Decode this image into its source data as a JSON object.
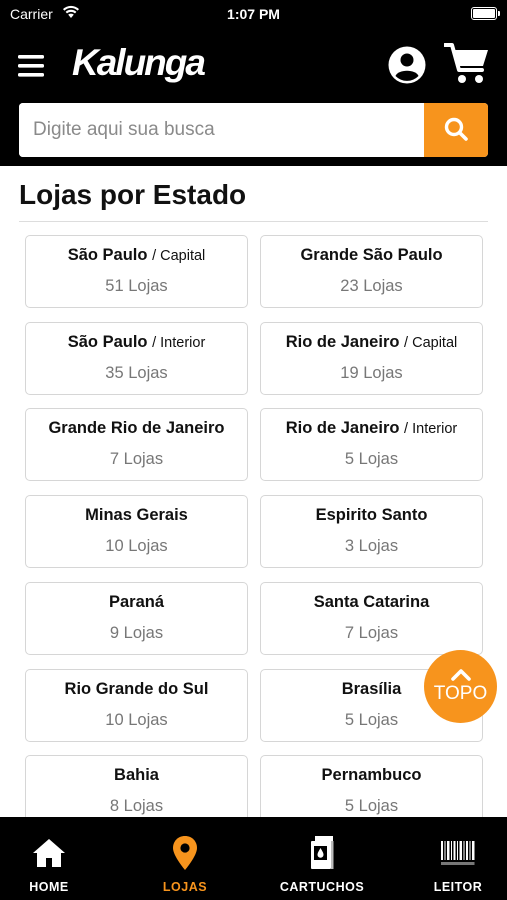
{
  "status_bar": {
    "carrier": "Carrier",
    "time": "1:07 PM",
    "battery_level": 1.0
  },
  "header": {
    "logo": "Kalunga",
    "icons": {
      "menu": "hamburger-menu-icon",
      "account": "account-icon",
      "cart": "shopping-cart-icon"
    }
  },
  "search": {
    "placeholder": "Digite aqui sua busca",
    "value": "",
    "button_icon": "search-icon"
  },
  "section_title": "Lojas por Estado",
  "stores": [
    {
      "name": "São Paulo",
      "qualifier": "/ Capital",
      "count": "51 Lojas"
    },
    {
      "name": "Grande São Paulo",
      "qualifier": "",
      "count": "23 Lojas"
    },
    {
      "name": "São Paulo",
      "qualifier": "/ Interior",
      "count": "35 Lojas"
    },
    {
      "name": "Rio de Janeiro",
      "qualifier": "/ Capital",
      "count": "19 Lojas"
    },
    {
      "name": "Grande Rio de Janeiro",
      "qualifier": "",
      "count": "7 Lojas"
    },
    {
      "name": "Rio de Janeiro",
      "qualifier": "/ Interior",
      "count": "5 Lojas"
    },
    {
      "name": "Minas Gerais",
      "qualifier": "",
      "count": "10 Lojas"
    },
    {
      "name": "Espirito Santo",
      "qualifier": "",
      "count": "3 Lojas"
    },
    {
      "name": "Paraná",
      "qualifier": "",
      "count": "9 Lojas"
    },
    {
      "name": "Santa Catarina",
      "qualifier": "",
      "count": "7 Lojas"
    },
    {
      "name": "Rio Grande do Sul",
      "qualifier": "",
      "count": "10 Lojas"
    },
    {
      "name": "Brasília",
      "qualifier": "",
      "count": "5 Lojas"
    },
    {
      "name": "Bahia",
      "qualifier": "",
      "count": "8 Lojas"
    },
    {
      "name": "Pernambuco",
      "qualifier": "",
      "count": "5 Lojas"
    }
  ],
  "top_button": {
    "label": "TOPO",
    "icon": "chevron-up-icon"
  },
  "tab_bar": {
    "active": "LOJAS",
    "items": [
      {
        "label": "HOME",
        "icon": "home-icon"
      },
      {
        "label": "LOJAS",
        "icon": "location-pin-icon"
      },
      {
        "label": "CARTUCHOS",
        "icon": "ink-cartridge-icon"
      },
      {
        "label": "LEITOR",
        "icon": "barcode-icon"
      }
    ]
  },
  "colors": {
    "accent": "#f7941d",
    "header_bg": "#000000",
    "card_border": "#d6d6d6",
    "count_text": "#777777"
  }
}
